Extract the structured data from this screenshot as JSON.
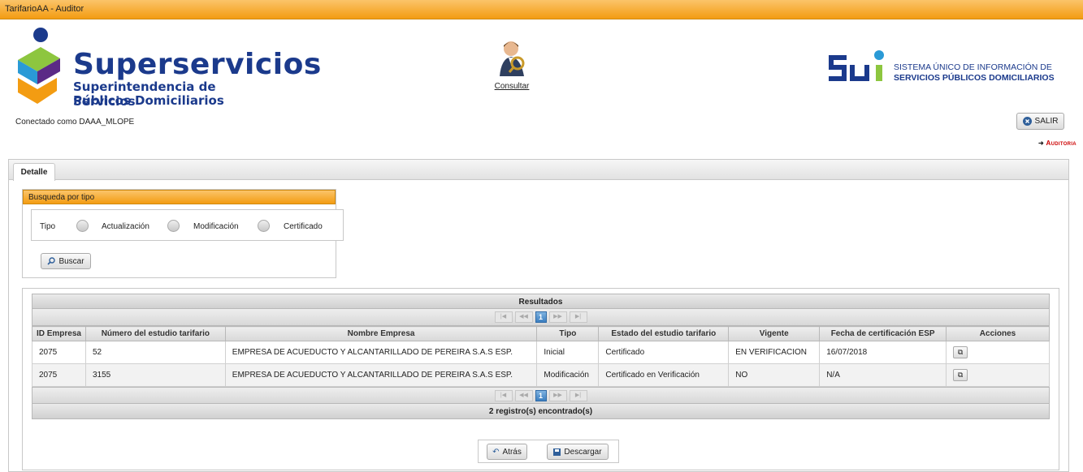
{
  "window": {
    "title": "TarifarioAA - Auditor"
  },
  "header": {
    "brand": {
      "name": "Superservicios",
      "subtitle_line1": "Superintendencia de Servicios",
      "subtitle_line2": "Públicos Domiciliarios"
    },
    "consultar": {
      "label": "Consultar",
      "icon": "auditor-person-icon"
    },
    "sui": {
      "logo_text": "SUI",
      "line1": "SISTEMA ÚNICO DE INFORMACIÓN DE",
      "line2": "SERVICIOS PÚBLICOS DOMICILIARIOS"
    },
    "connected_as": "Conectado como DAAA_MLOPE",
    "salir_label": "SALIR",
    "auditoria_label": "Auditoria"
  },
  "tabs": [
    {
      "label": "Detalle",
      "active": true
    }
  ],
  "search": {
    "title": "Busqueda por tipo",
    "tipo_label": "Tipo",
    "options": [
      "Actualización",
      "Modificación",
      "Certificado"
    ],
    "buscar_label": "Buscar"
  },
  "results": {
    "title": "Resultados",
    "current_page": "1",
    "columns": [
      "ID Empresa",
      "Número del estudio tarifario",
      "Nombre Empresa",
      "Tipo",
      "Estado del estudio tarifario",
      "Vigente",
      "Fecha de certificación ESP",
      "Acciones"
    ],
    "rows": [
      [
        "2075",
        "52",
        "EMPRESA DE ACUEDUCTO Y ALCANTARILLADO DE PEREIRA S.A.S ESP.",
        "Inicial",
        "Certificado",
        "EN VERIFICACION",
        "16/07/2018"
      ],
      [
        "2075",
        "3155",
        "EMPRESA DE ACUEDUCTO Y ALCANTARILLADO DE PEREIRA S.A.S ESP.",
        "Modificación",
        "Certificado en Verificación",
        "NO",
        "N/A"
      ]
    ],
    "footer": "2 registro(s) encontrado(s)"
  },
  "actions": {
    "atras_label": "Atrás",
    "descargar_label": "Descargar"
  },
  "colors": {
    "accent_orange": "#f39c12",
    "brand_blue": "#1b3a8c",
    "brand_green": "#8dc63f",
    "auditoria_red": "#cc0000"
  }
}
